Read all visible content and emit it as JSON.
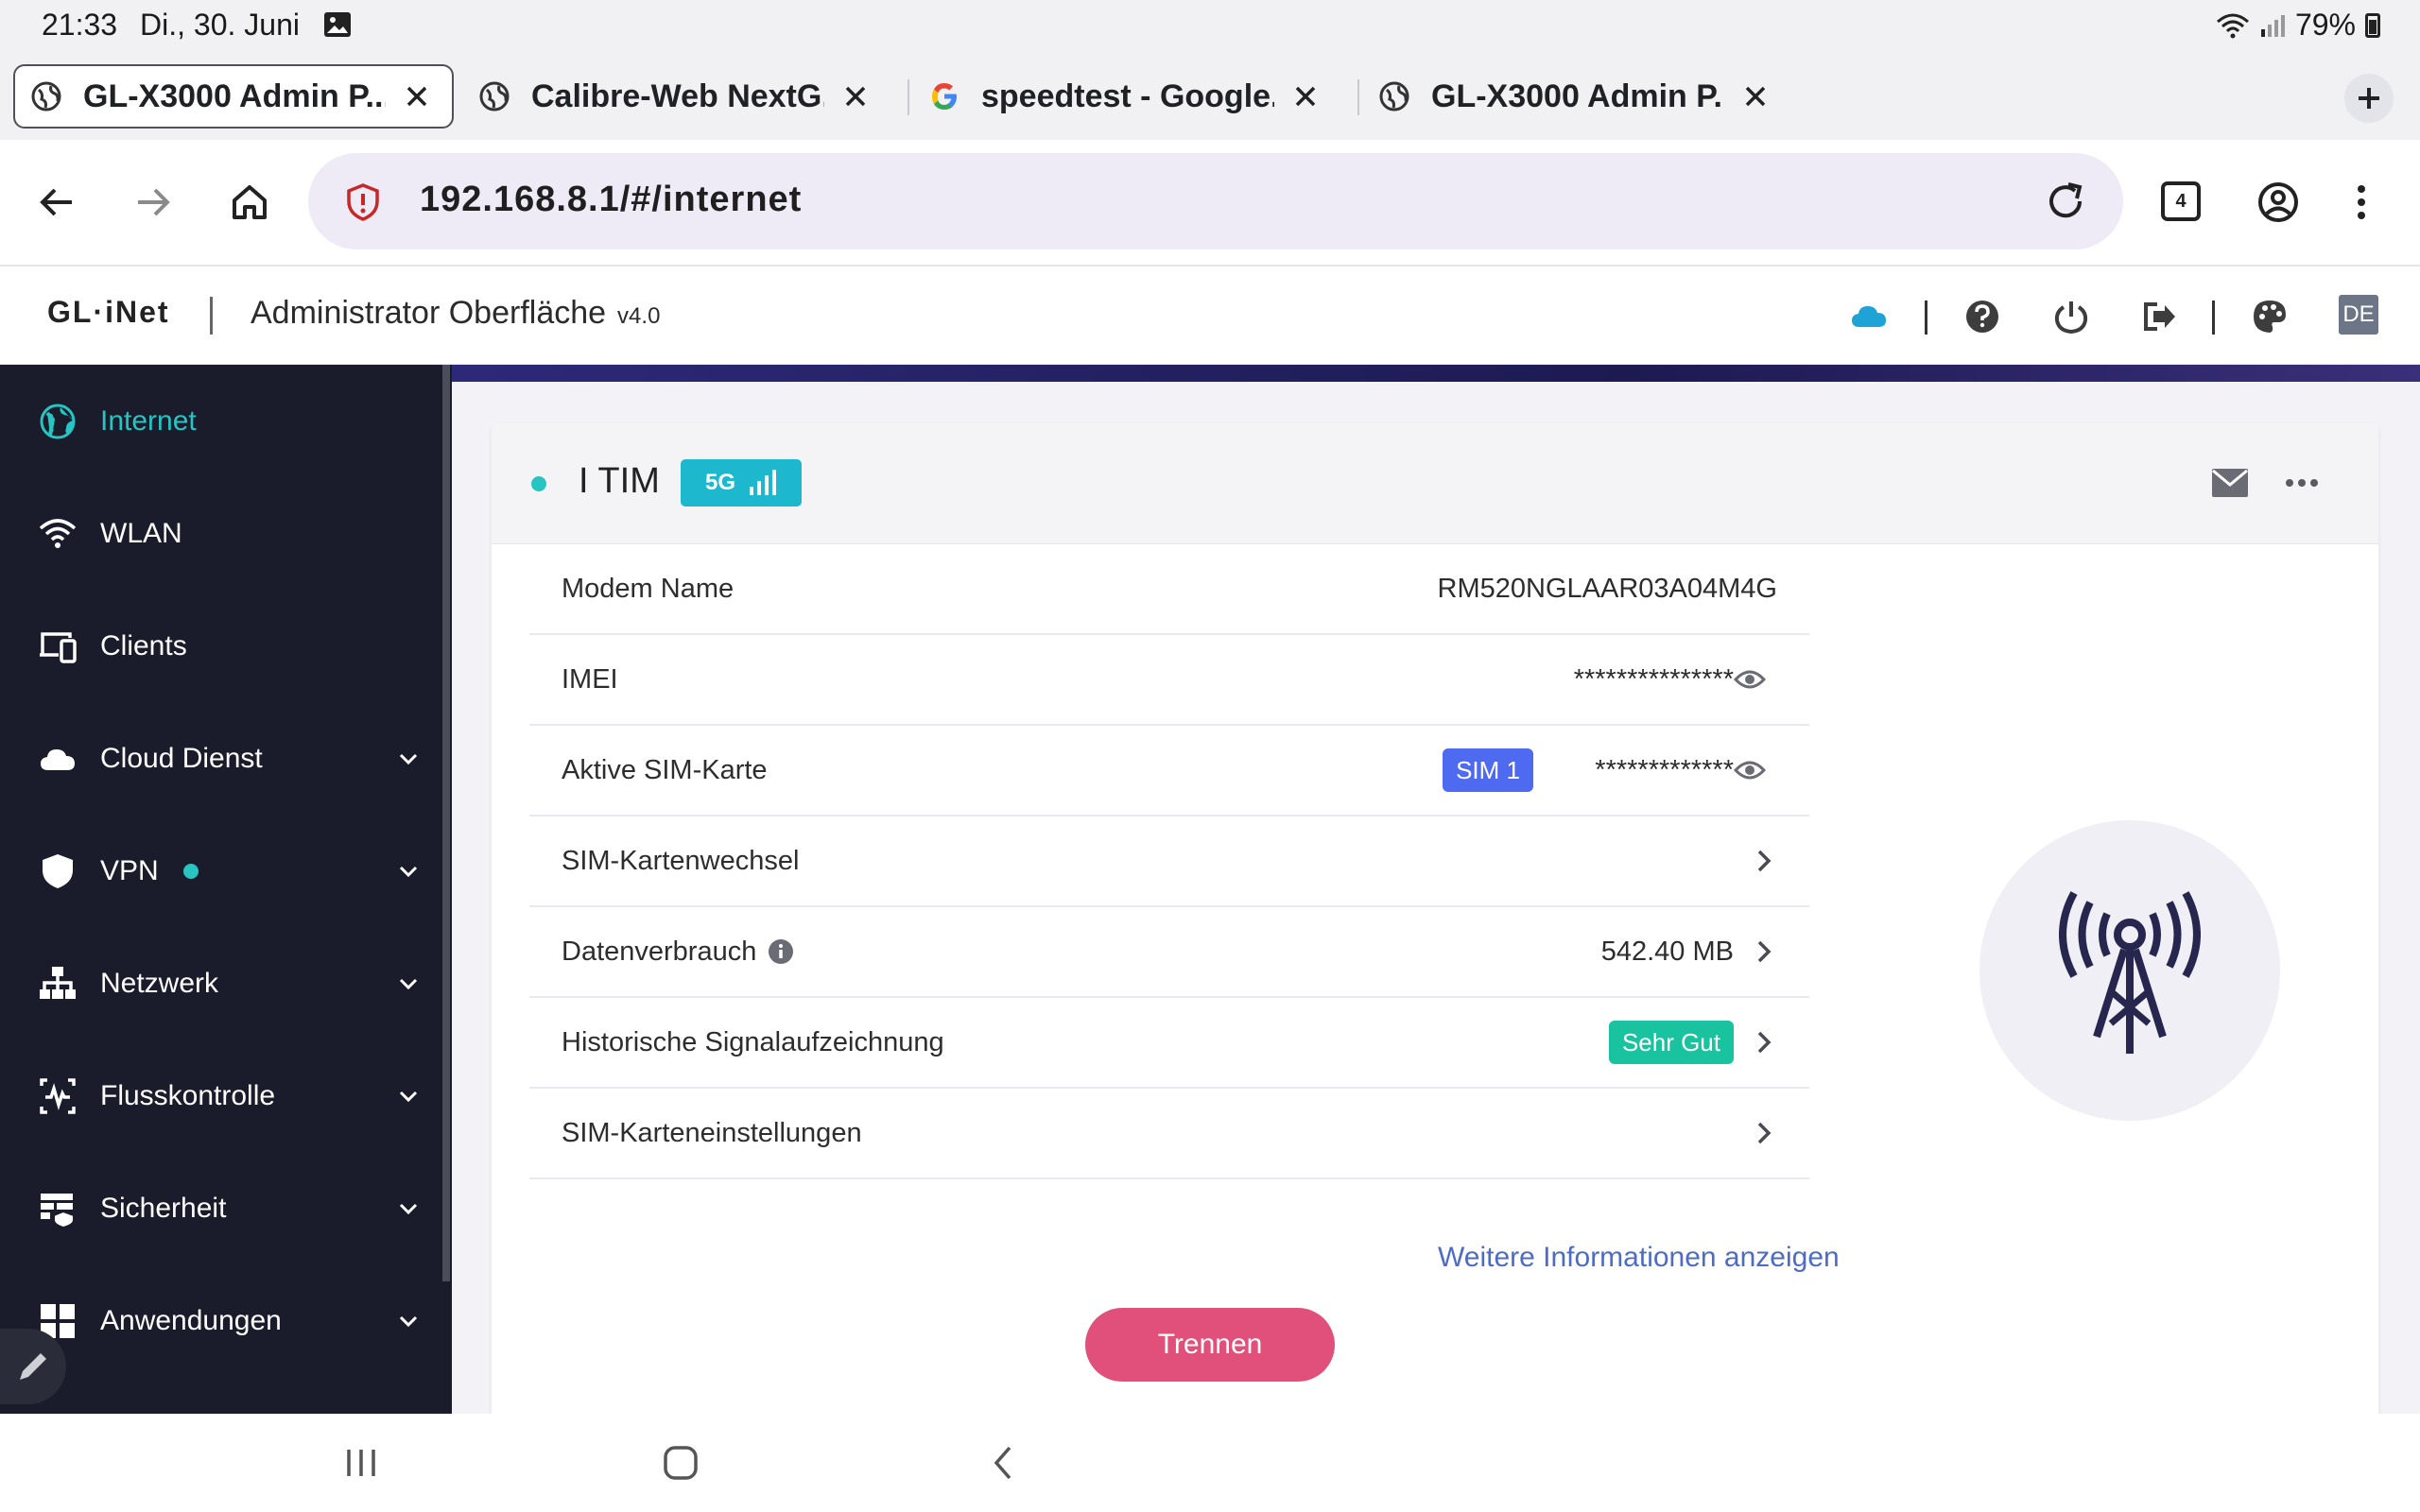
{
  "status_bar": {
    "time": "21:33",
    "date": "Di., 30. Juni",
    "battery": "79%"
  },
  "tabs": [
    {
      "title": "GL-X3000 Admin P...",
      "favicon": "globe-icon",
      "active": true
    },
    {
      "title": "Calibre-Web NextG...",
      "favicon": "globe-icon",
      "active": false
    },
    {
      "title": "speedtest - Google...",
      "favicon": "google-icon",
      "active": false
    },
    {
      "title": "GL-X3000 Admin P...",
      "favicon": "globe-icon",
      "active": false
    }
  ],
  "toolbar": {
    "url": "192.168.8.1/#/internet",
    "tab_count": "4"
  },
  "header": {
    "logo": "GL·iNet",
    "title": "Administrator Oberfläche",
    "version": "v4.0",
    "language": "DE"
  },
  "sidebar": {
    "items": [
      {
        "label": "Internet",
        "icon": "globe-icon"
      },
      {
        "label": "WLAN",
        "icon": "wifi-icon"
      },
      {
        "label": "Clients",
        "icon": "devices-icon"
      },
      {
        "label": "Cloud Dienst",
        "icon": "cloud-icon"
      },
      {
        "label": "VPN",
        "icon": "shield-icon"
      },
      {
        "label": "Netzwerk",
        "icon": "network-icon"
      },
      {
        "label": "Flusskontrolle",
        "icon": "flow-control-icon"
      },
      {
        "label": "Sicherheit",
        "icon": "firewall-icon"
      },
      {
        "label": "Anwendungen",
        "icon": "apps-icon"
      }
    ]
  },
  "card": {
    "carrier": "I TIM",
    "network_type": "5G",
    "rows": {
      "modem_name": {
        "label": "Modem Name",
        "value": "RM520NGLAAR03A04M4G"
      },
      "imei": {
        "label": "IMEI",
        "value": "***************"
      },
      "active_sim": {
        "label": "Aktive SIM-Karte",
        "badge": "SIM 1",
        "value": "*************"
      },
      "sim_switch": {
        "label": "SIM-Kartenwechsel"
      },
      "data_usage": {
        "label": "Datenverbrauch",
        "value": "542.40 MB"
      },
      "signal_history": {
        "label": "Historische Signalaufzeichnung",
        "badge": "Sehr Gut"
      },
      "sim_settings": {
        "label": "SIM-Karteneinstellungen"
      }
    },
    "more_info": "Weitere Informationen anzeigen",
    "disconnect": "Trennen"
  },
  "colors": {
    "accent": "#27c4c2",
    "sidebar_bg": "#1a1c2c",
    "badge_5g": "#1db7ce",
    "sim_badge": "#4e6af0",
    "quality_badge": "#19c39f",
    "disconnect": "#e0507a",
    "link": "#4e6cc4"
  }
}
